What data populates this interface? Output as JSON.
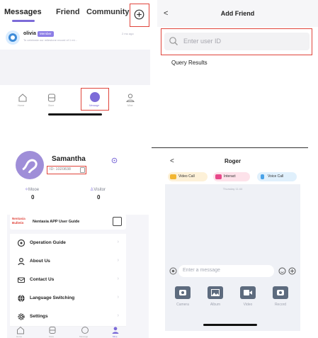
{
  "messages_screen": {
    "tabs": [
      "Messages",
      "Friend",
      "Community"
    ],
    "add_icon": "plus-circle-icon",
    "conversation": {
      "name": "olivia",
      "badge": "Member",
      "time": "2 mo ago",
      "preview": "To celebrate our milestone record of 1 mi..."
    },
    "nav": [
      "Home",
      "Store",
      "Message",
      "Mine"
    ]
  },
  "add_friend": {
    "back": "<",
    "title": "Add Friend",
    "search_placeholder": "Enter user ID",
    "results_label": "Query Results"
  },
  "profile": {
    "name": "Samantha",
    "user_id": "ID: 1020838",
    "stats": [
      {
        "label": "Mooe",
        "value": "0"
      },
      {
        "label": "Visitor",
        "value": "0"
      }
    ],
    "banner_brand": "Nentasia Bulletin",
    "banner_text": "Nentasia APP User Guide",
    "menu": [
      "Operation Guide",
      "About Us",
      "Contact Us",
      "Language Switching",
      "Settings"
    ],
    "nav": [
      "Home",
      "Store",
      "Message",
      "Mine"
    ]
  },
  "chat": {
    "back": "<",
    "title": "Roger",
    "actions": [
      "Video Call",
      "Interact",
      "Voice Call"
    ],
    "timestamp": "Thursday 11:44",
    "input_placeholder": "Enter a message",
    "tools": [
      "Camera",
      "Album",
      "Video",
      "Record"
    ]
  },
  "colors": {
    "accent": "#7c6bd8",
    "highlight": "#e0443b",
    "badge": "#8c7de6",
    "tool": "#5d6b7e"
  }
}
